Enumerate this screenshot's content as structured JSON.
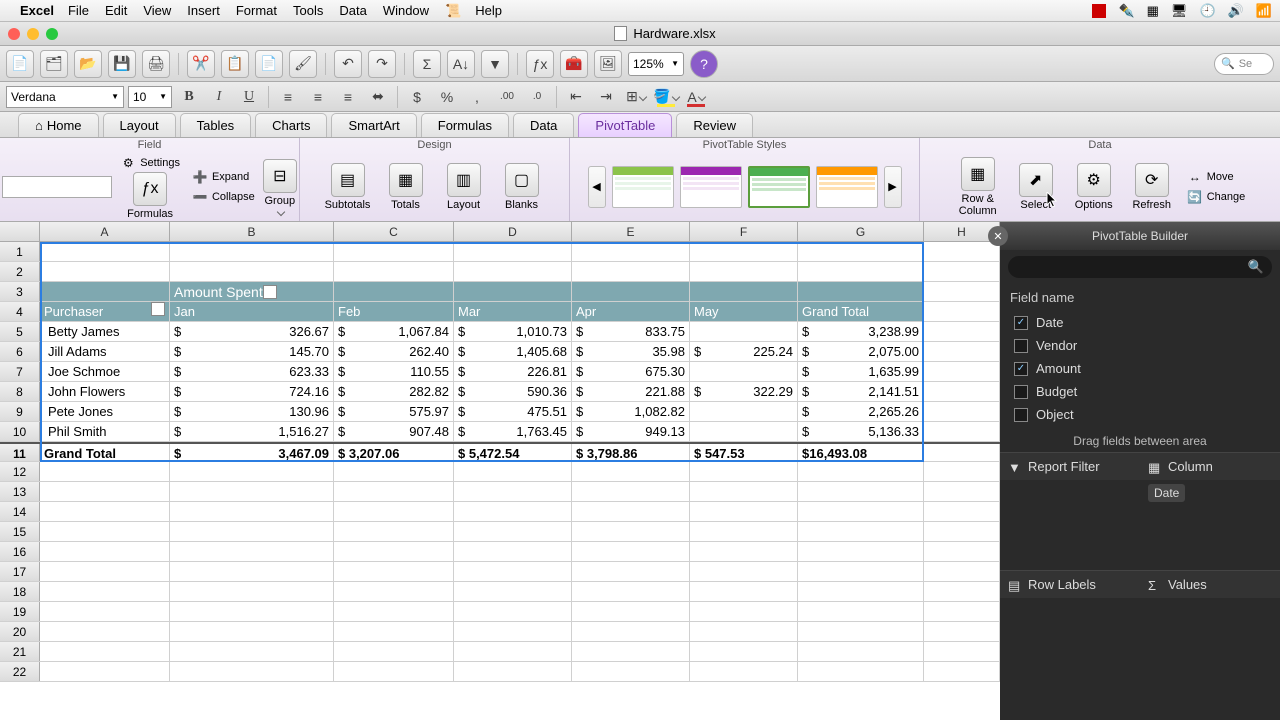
{
  "menubar": {
    "app": "Excel",
    "items": [
      "File",
      "Edit",
      "View",
      "Insert",
      "Format",
      "Tools",
      "Data",
      "Window",
      "Help"
    ]
  },
  "window": {
    "title": "Hardware.xlsx"
  },
  "toolbar": {
    "zoom": "125%",
    "search_placeholder": "Se"
  },
  "format": {
    "font": "Verdana",
    "size": "10"
  },
  "ribbon_tabs": [
    "Home",
    "Layout",
    "Tables",
    "Charts",
    "SmartArt",
    "Formulas",
    "Data",
    "PivotTable",
    "Review"
  ],
  "ribbon_active": "PivotTable",
  "ribbon": {
    "group_field": "Field",
    "settings": "Settings",
    "formulas": "Formulas",
    "expand": "Expand",
    "collapse": "Collapse",
    "group": "Group",
    "group_design": "Design",
    "subtotals": "Subtotals",
    "totals": "Totals",
    "layout": "Layout",
    "blanks": "Blanks",
    "group_styles": "PivotTable Styles",
    "group_data": "Data",
    "row_column": "Row &\nColumn",
    "select": "Select",
    "options": "Options",
    "refresh": "Refresh",
    "move": "Move",
    "change": "Change"
  },
  "columns": [
    "A",
    "B",
    "C",
    "D",
    "E",
    "F",
    "G",
    "H"
  ],
  "pivot": {
    "values_label": "Amount Spent",
    "row_field": "Purchaser",
    "col_labels": [
      "Jan",
      "Feb",
      "Mar",
      "Apr",
      "May"
    ],
    "grand_total_label": "Grand Total",
    "rows": [
      {
        "name": "Betty James",
        "vals": [
          "326.67",
          "1,067.84",
          "1,010.73",
          "833.75",
          ""
        ],
        "total": "3,238.99"
      },
      {
        "name": "Jill Adams",
        "vals": [
          "145.70",
          "262.40",
          "1,405.68",
          "35.98",
          "225.24"
        ],
        "total": "2,075.00"
      },
      {
        "name": "Joe Schmoe",
        "vals": [
          "623.33",
          "110.55",
          "226.81",
          "675.30",
          ""
        ],
        "total": "1,635.99"
      },
      {
        "name": "John Flowers",
        "vals": [
          "724.16",
          "282.82",
          "590.36",
          "221.88",
          "322.29"
        ],
        "total": "2,141.51"
      },
      {
        "name": "Pete Jones",
        "vals": [
          "130.96",
          "575.97",
          "475.51",
          "1,082.82",
          ""
        ],
        "total": "2,265.26"
      },
      {
        "name": "Phil Smith",
        "vals": [
          "1,516.27",
          "907.48",
          "1,763.45",
          "949.13",
          ""
        ],
        "total": "5,136.33"
      }
    ],
    "col_totals": [
      "3,467.09",
      "3,207.06",
      "5,472.54",
      "3,798.86",
      "547.53"
    ],
    "grand_total": "16,493.08"
  },
  "builder": {
    "title": "PivotTable Builder",
    "field_name_label": "Field name",
    "fields": [
      {
        "name": "Date",
        "checked": true
      },
      {
        "name": "Vendor",
        "checked": false
      },
      {
        "name": "Amount",
        "checked": true
      },
      {
        "name": "Budget",
        "checked": false
      },
      {
        "name": "Object",
        "checked": false
      }
    ],
    "drag_hint": "Drag fields between area",
    "zones": {
      "filter": "Report Filter",
      "columns": "Column",
      "rows": "Row Labels",
      "values": "Values",
      "columns_item": "Date"
    }
  }
}
